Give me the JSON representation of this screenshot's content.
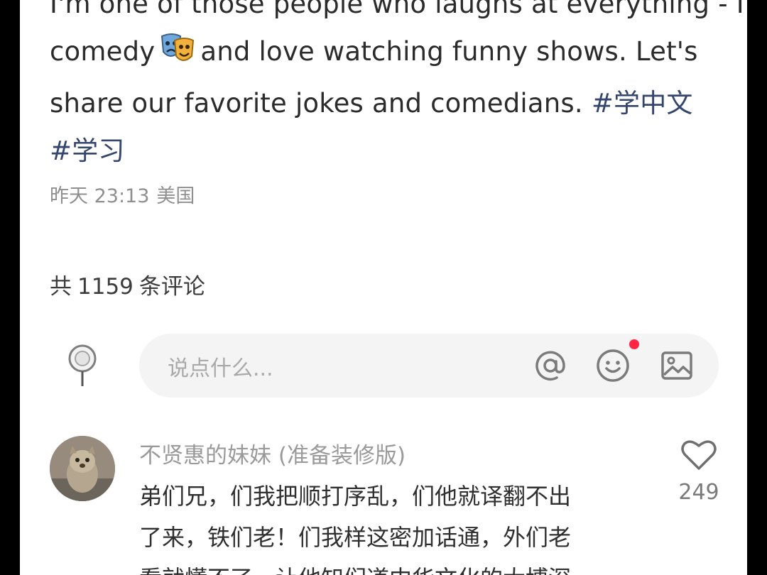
{
  "post": {
    "lines": [
      "I'm one of those people who laughs at everything - I",
      "comedy",
      "and love watching funny shows. Let's",
      "share our favorite jokes and comedians.",
      "#学中文",
      "#学习"
    ],
    "time": "昨天 23:13",
    "location": "美国"
  },
  "comments_header": {
    "prefix": "共",
    "count": "1159",
    "suffix": "条评论"
  },
  "composer": {
    "placeholder": "说点什么..."
  },
  "comment": {
    "username": "不贤惠的妹妹 (准备装修版)",
    "lines": [
      "弟们兄，们我把顺打序乱，们他就译翻不出",
      "了来，铁们老！们我样这密加话通，外们老",
      "看就懂不了，让他知们道中华文化的大博深"
    ],
    "likes": "249"
  },
  "colors": {
    "hashtag": "#34466d",
    "notification_dot": "#ff2442"
  },
  "icons": {
    "pin": "location-pin-icon",
    "mention": "at-sign-icon",
    "emoji": "smiley-icon",
    "image": "image-icon",
    "heart": "heart-icon",
    "comedy": "comedy-masks-icon"
  }
}
